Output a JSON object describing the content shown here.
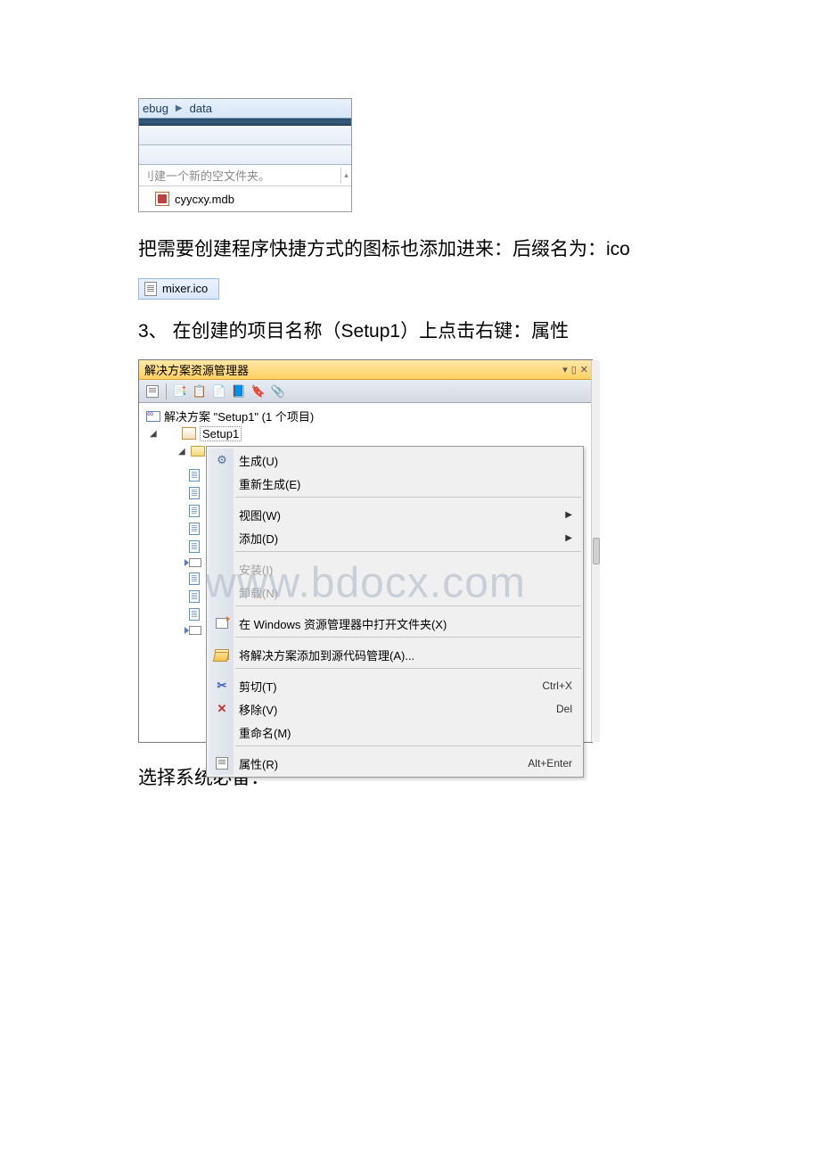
{
  "win1": {
    "addr_seg1": "ebug",
    "addr_seg2": "data",
    "tip": "刂建一个新的空文件夹。",
    "file": "cyycxy.mdb"
  },
  "para1": "把需要创建程序快捷方式的图标也添加进来：后缀名为：ico",
  "ico_file": "mixer.ico",
  "para2": "3、 在创建的项目名称（Setup1）上点击右键：属性",
  "solex": {
    "title": "解决方案资源管理器",
    "solution_line": "解决方案 \"Setup1\" (1 个项目)",
    "project_name": "Setup1"
  },
  "ctx": {
    "build": "生成(U)",
    "rebuild": "重新生成(E)",
    "view": "视图(W)",
    "add": "添加(D)",
    "install": "安装(I)",
    "uninstall": "卸载(N)",
    "open_explorer": "在 Windows 资源管理器中打开文件夹(X)",
    "add_scc": "将解决方案添加到源代码管理(A)...",
    "cut": "剪切(T)",
    "cut_sc": "Ctrl+X",
    "remove": "移除(V)",
    "remove_sc": "Del",
    "rename": "重命名(M)",
    "properties": "属性(R)",
    "properties_sc": "Alt+Enter"
  },
  "watermark": "www.bdocx.com",
  "para3": "选择系统必备："
}
